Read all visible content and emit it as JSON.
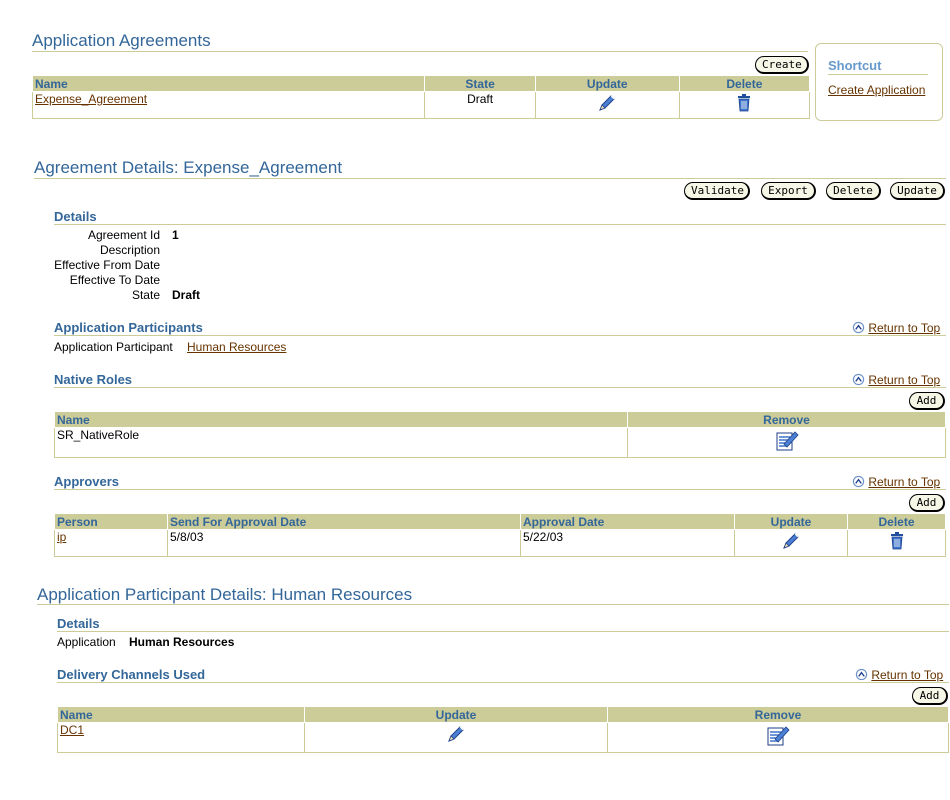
{
  "app_agreements": {
    "title": "Application Agreements",
    "create_label": "Create",
    "columns": [
      "Name",
      "State",
      "Update",
      "Delete"
    ],
    "rows": [
      {
        "name": "Expense_Agreement",
        "state": "Draft"
      }
    ]
  },
  "shortcut": {
    "title": "Shortcut",
    "link": "Create Application"
  },
  "agreement_details": {
    "title": "Agreement Details: Expense_Agreement",
    "buttons": {
      "validate": "Validate",
      "export": "Export",
      "delete": "Delete",
      "update": "Update"
    },
    "details_heading": "Details",
    "fields": {
      "agreement_id_label": "Agreement Id",
      "agreement_id": "1",
      "description_label": "Description",
      "eff_from_label": "Effective From Date",
      "eff_to_label": "Effective To Date",
      "state_label": "State",
      "state": "Draft"
    },
    "return_to_top": "Return to Top",
    "participants": {
      "heading": "Application Participants",
      "label": "Application Participant",
      "value": "Human Resources"
    },
    "native_roles": {
      "heading": "Native Roles",
      "add_label": "Add",
      "columns": [
        "Name",
        "Remove"
      ],
      "rows": [
        {
          "name": "SR_NativeRole"
        }
      ]
    },
    "approvers": {
      "heading": "Approvers",
      "add_label": "Add",
      "columns": [
        "Person",
        "Send For Approval Date",
        "Approval Date",
        "Update",
        "Delete"
      ],
      "rows": [
        {
          "person": "ip",
          "send_date": "5/8/03",
          "approval_date": "5/22/03"
        }
      ]
    }
  },
  "participant_details": {
    "title": "Application Participant Details: Human Resources",
    "details_heading": "Details",
    "application_label": "Application",
    "application_value": "Human Resources",
    "delivery": {
      "heading": "Delivery Channels Used",
      "add_label": "Add",
      "return_to_top": "Return to Top",
      "columns": [
        "Name",
        "Update",
        "Remove"
      ],
      "rows": [
        {
          "name": "DC1"
        }
      ]
    }
  },
  "colors": {
    "heading": "#336699",
    "link": "#663300",
    "header_bg": "#cccc99",
    "icon": "#3366cc"
  },
  "icons": [
    "pencil-icon",
    "trash-icon",
    "remove-icon",
    "return-to-top-icon"
  ]
}
